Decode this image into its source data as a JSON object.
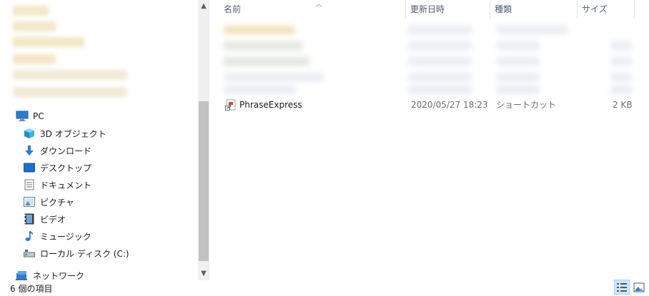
{
  "nav": {
    "items": [
      {
        "label": "PC",
        "icon": "pc-icon"
      },
      {
        "label": "3D オブジェクト",
        "icon": "3d-objects-icon"
      },
      {
        "label": "ダウンロード",
        "icon": "download-icon"
      },
      {
        "label": "デスクトップ",
        "icon": "desktop-icon"
      },
      {
        "label": "ドキュメント",
        "icon": "document-icon"
      },
      {
        "label": "ピクチャ",
        "icon": "pictures-icon"
      },
      {
        "label": "ビデオ",
        "icon": "video-icon"
      },
      {
        "label": "ミュージック",
        "icon": "music-icon"
      },
      {
        "label": "ローカル ディスク (C:)",
        "icon": "local-disk-icon"
      },
      {
        "label": "ネットワーク",
        "icon": "network-icon"
      }
    ]
  },
  "columns": {
    "name": "名前",
    "modified": "更新日時",
    "type": "種類",
    "size": "サイズ"
  },
  "files": [
    {
      "name": "PhraseExpress",
      "modified": "2020/05/27 18:23",
      "type": "ショートカット",
      "size": "2 KB",
      "icon": "shortcut-icon"
    }
  ],
  "status": {
    "item_count": "6 個の項目"
  },
  "colors": {
    "selection": "#cce8ff",
    "header_text": "#4c607a"
  }
}
